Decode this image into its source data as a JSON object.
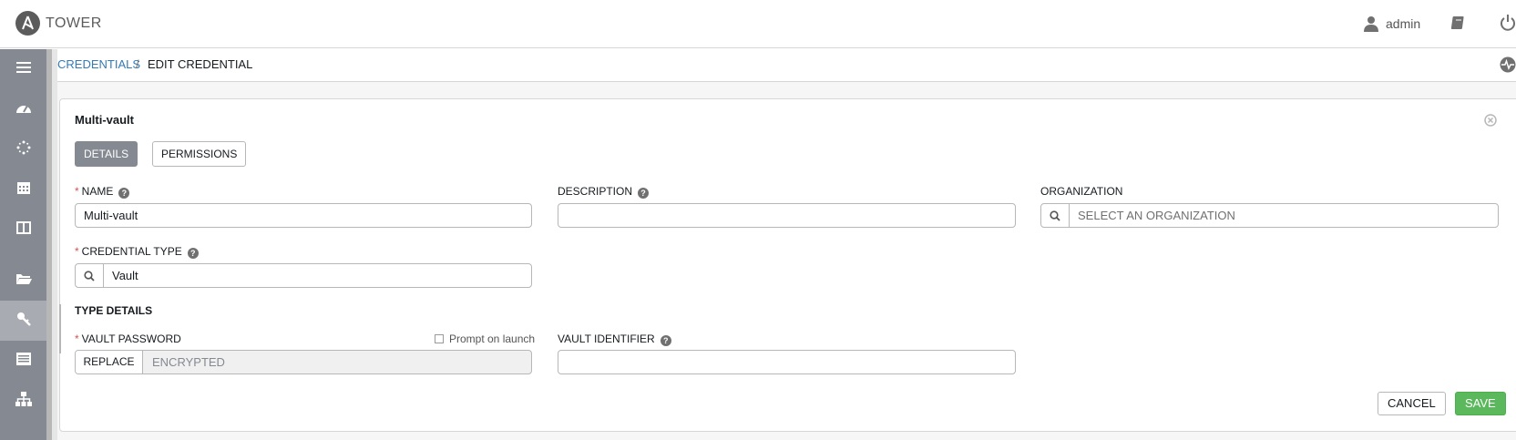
{
  "app": {
    "brand": "TOWER"
  },
  "user": {
    "name": "admin"
  },
  "breadcrumb": {
    "parent": "CREDENTIALS",
    "separator": "/",
    "current": "EDIT CREDENTIAL"
  },
  "sidebar": {
    "items": [
      {
        "icon": "menu-icon"
      },
      {
        "icon": "dashboard-icon"
      },
      {
        "icon": "jobs-spinner-icon"
      },
      {
        "icon": "calendar-icon"
      },
      {
        "icon": "portal-icon"
      },
      {
        "icon": "folder-icon"
      },
      {
        "icon": "key-icon",
        "active": true
      },
      {
        "icon": "inventory-icon"
      },
      {
        "icon": "sitemap-icon"
      }
    ]
  },
  "panel": {
    "title": "Multi-vault",
    "tabs": {
      "details": "DETAILS",
      "permissions": "PERMISSIONS"
    }
  },
  "form": {
    "name": {
      "label": "NAME",
      "value": "Multi-vault"
    },
    "description": {
      "label": "DESCRIPTION",
      "value": ""
    },
    "organization": {
      "label": "ORGANIZATION",
      "placeholder": "SELECT AN ORGANIZATION"
    },
    "credential_type": {
      "label": "CREDENTIAL TYPE",
      "value": "Vault"
    },
    "type_details_title": "TYPE DETAILS",
    "vault_password": {
      "label": "VAULT PASSWORD",
      "prompt_label": "Prompt on launch",
      "replace_label": "REPLACE",
      "value": "ENCRYPTED"
    },
    "vault_identifier": {
      "label": "VAULT IDENTIFIER",
      "value": ""
    }
  },
  "actions": {
    "cancel": "CANCEL",
    "save": "SAVE"
  },
  "colors": {
    "accent": "#337ab7",
    "sidebar": "#848992",
    "save": "#5cb85c",
    "required": "#d9534f"
  }
}
